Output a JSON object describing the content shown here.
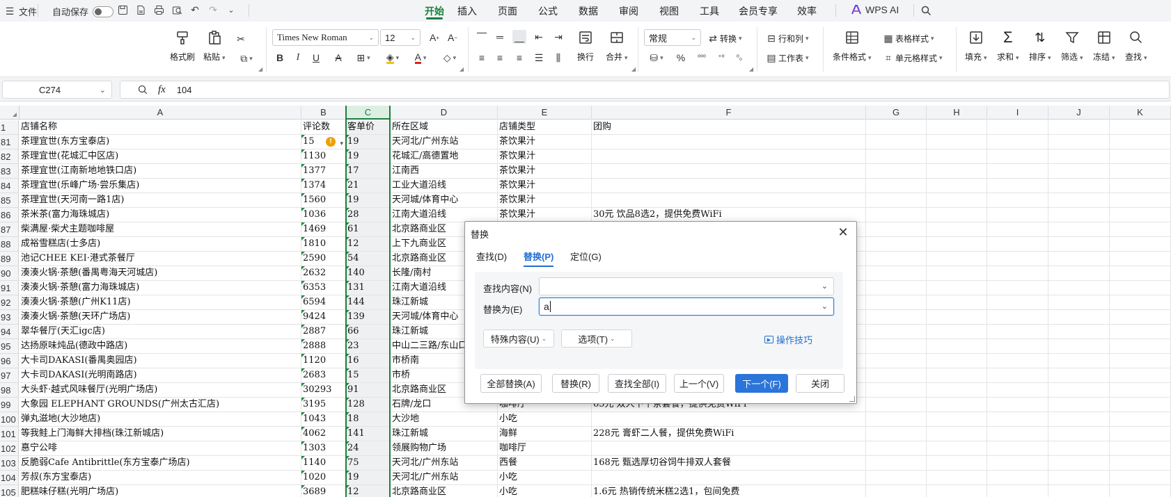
{
  "menubar": {
    "file": "文件",
    "autosave": "自动保存",
    "tabs": [
      "开始",
      "插入",
      "页面",
      "公式",
      "数据",
      "审阅",
      "视图",
      "工具",
      "会员专享",
      "效率"
    ],
    "active_tab": "开始",
    "ai": "WPS AI",
    "accent": "#1a7f3c"
  },
  "ribbon": {
    "format_painter": "格式刷",
    "paste": "粘贴",
    "font_name": "Times New Roman",
    "font_size": "12",
    "wrap": "换行",
    "merge": "合并",
    "number_format": "常规",
    "convert": "转换",
    "row_col": "行和列",
    "worksheet": "工作表",
    "cond_format": "条件格式",
    "table_style": "表格样式",
    "cell_style": "单元格样式",
    "fill": "填充",
    "sum": "求和",
    "sort": "排序",
    "filter": "筛选",
    "freeze": "冻结",
    "find": "查找"
  },
  "formula_bar": {
    "cell_ref": "C274",
    "value": "104"
  },
  "sheet": {
    "columns": [
      "A",
      "B",
      "C",
      "D",
      "E",
      "F",
      "G",
      "H",
      "I",
      "J",
      "K"
    ],
    "selected_column": "C",
    "header_row_number": "1",
    "header": [
      "店铺名称",
      "评论数",
      "客单价",
      "所在区域",
      "店铺类型",
      "团购"
    ],
    "rows": [
      {
        "n": "81",
        "a": "茶理宜世(东方宝泰店)",
        "b": "15",
        "c": "19",
        "d": "天河北/广州东站",
        "e": "茶饮果汁",
        "f": "",
        "warn": true
      },
      {
        "n": "82",
        "a": "茶理宜世(花城汇中区店)",
        "b": "1130",
        "c": "19",
        "d": "花城汇/高德置地",
        "e": "茶饮果汁",
        "f": ""
      },
      {
        "n": "83",
        "a": "茶理宜世(江南新地地铁口店)",
        "b": "1377",
        "c": "17",
        "d": "江南西",
        "e": "茶饮果汁",
        "f": ""
      },
      {
        "n": "84",
        "a": "茶理宜世(乐峰广场·尝乐集店)",
        "b": "1374",
        "c": "21",
        "d": "工业大道沿线",
        "e": "茶饮果汁",
        "f": ""
      },
      {
        "n": "85",
        "a": "茶理宜世(天河南一路1店)",
        "b": "1560",
        "c": "19",
        "d": "天河城/体育中心",
        "e": "茶饮果汁",
        "f": ""
      },
      {
        "n": "86",
        "a": "茶米茶(富力海珠城店)",
        "b": "1036",
        "c": "28",
        "d": "江南大道沿线",
        "e": "茶饮果汁",
        "f": "30元 饮品8选2，提供免费WiFi"
      },
      {
        "n": "87",
        "a": "柴满屋·柴犬主题咖啡屋",
        "b": "1469",
        "c": "61",
        "d": "北京路商业区",
        "e": "",
        "f": ""
      },
      {
        "n": "88",
        "a": "成裕雪糕店(士多店)",
        "b": "1810",
        "c": "12",
        "d": "上下九商业区",
        "e": "",
        "f": ""
      },
      {
        "n": "89",
        "a": "池记CHEE KEI·港式茶餐厅",
        "b": "2590",
        "c": "54",
        "d": "北京路商业区",
        "e": "",
        "f": ""
      },
      {
        "n": "90",
        "a": "湊湊火锅·茶憩(番禺粤海天河城店)",
        "b": "2632",
        "c": "140",
        "d": "长隆/南村",
        "e": "",
        "f": ""
      },
      {
        "n": "91",
        "a": "湊湊火锅·茶憩(富力海珠城店)",
        "b": "6353",
        "c": "131",
        "d": "江南大道沿线",
        "e": "",
        "f": ""
      },
      {
        "n": "92",
        "a": "湊湊火锅·茶憩(广州K11店)",
        "b": "6594",
        "c": "144",
        "d": "珠江新城",
        "e": "",
        "f": ""
      },
      {
        "n": "93",
        "a": "湊湊火锅·茶憩(天环广场店)",
        "b": "9424",
        "c": "139",
        "d": "天河城/体育中心",
        "e": "",
        "f": ""
      },
      {
        "n": "94",
        "a": "翠华餐厅(天汇igc店)",
        "b": "2887",
        "c": "66",
        "d": "珠江新城",
        "e": "",
        "f": ""
      },
      {
        "n": "95",
        "a": "达扬原味炖品(德政中路店)",
        "b": "2888",
        "c": "23",
        "d": "中山二三路/东山口",
        "e": "",
        "f": ""
      },
      {
        "n": "96",
        "a": "大卡司DAKASI(番禺奥园店)",
        "b": "1120",
        "c": "16",
        "d": "市桥南",
        "e": "",
        "f": ""
      },
      {
        "n": "97",
        "a": "大卡司DAKASI(光明南路店)",
        "b": "2683",
        "c": "15",
        "d": "市桥",
        "e": "",
        "f": ""
      },
      {
        "n": "98",
        "a": "大头虾·越式风味餐厅(光明广场店)",
        "b": "30293",
        "c": "91",
        "d": "北京路商业区",
        "e": "",
        "f": ""
      },
      {
        "n": "99",
        "a": "大象园 ELEPHANT GROUNDS(广州太古汇店)",
        "b": "3195",
        "c": "128",
        "d": "石牌/龙口",
        "e": "咖啡厅",
        "f": "65元 双人下午茶套餐，提供免费WiFi"
      },
      {
        "n": "100",
        "a": "弹丸滋地(大沙地店)",
        "b": "1043",
        "c": "18",
        "d": "大沙地",
        "e": "小吃",
        "f": ""
      },
      {
        "n": "101",
        "a": "等我鲑上门海鲜大排档(珠江新城店)",
        "b": "4062",
        "c": "141",
        "d": "珠江新城",
        "e": "海鲜",
        "f": "228元 膏虾二人餐，提供免费WiFi"
      },
      {
        "n": "102",
        "a": "惪宁公啡",
        "b": "1303",
        "c": "24",
        "d": "领展购物广场",
        "e": "咖啡厅",
        "f": ""
      },
      {
        "n": "103",
        "a": "反脆弱Cafe Antibrittle(东方宝泰广场店)",
        "b": "1140",
        "c": "75",
        "d": "天河北/广州东站",
        "e": "西餐",
        "f": "168元 甄选厚切谷饲牛排双人套餐"
      },
      {
        "n": "104",
        "a": "芳叔(东方宝泰店)",
        "b": "1020",
        "c": "19",
        "d": "天河北/广州东站",
        "e": "小吃",
        "f": ""
      },
      {
        "n": "105",
        "a": "肥糕味仔糕(光明广场店)",
        "b": "3689",
        "c": "12",
        "d": "北京路商业区",
        "e": "小吃",
        "f": "1.6元 热销传统米糕2选1，包间免费"
      }
    ]
  },
  "dialog": {
    "title": "替换",
    "tabs": [
      "查找(D)",
      "替换(P)",
      "定位(G)"
    ],
    "active_tab": "替换(P)",
    "find_label": "查找内容(N)",
    "find_value": "",
    "replace_label": "替换为(E)",
    "replace_value": "a",
    "special": "特殊内容(U)",
    "options": "选项(T)",
    "tips": "操作技巧",
    "buttons": [
      "全部替换(A)",
      "替换(R)",
      "查找全部(I)",
      "上一个(V)",
      "下一个(F)",
      "关闭"
    ],
    "primary": "#2b74d9"
  }
}
